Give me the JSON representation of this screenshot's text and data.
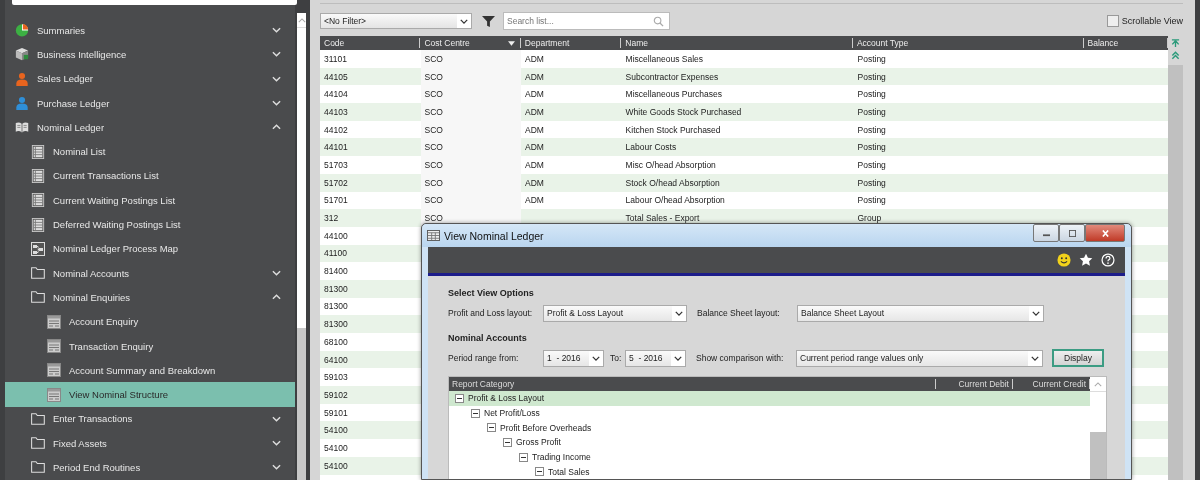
{
  "sidebar": {
    "items": [
      {
        "label": "Summaries",
        "kind": "pie",
        "expanded": false,
        "selected": false
      },
      {
        "label": "Business Intelligence",
        "kind": "box",
        "expanded": false,
        "selected": false
      },
      {
        "label": "Sales Ledger",
        "kind": "person",
        "color": "#e8641e",
        "expanded": false,
        "selected": false
      },
      {
        "label": "Purchase Ledger",
        "kind": "person",
        "color": "#2f8fd8",
        "expanded": false,
        "selected": false
      },
      {
        "label": "Nominal Ledger",
        "kind": "book",
        "expanded": true,
        "selected": false,
        "children": [
          {
            "label": "Nominal List",
            "kind": "list",
            "selected": false
          },
          {
            "label": "Current Transactions List",
            "kind": "list",
            "selected": false
          },
          {
            "label": "Current Waiting Postings List",
            "kind": "list",
            "selected": false
          },
          {
            "label": "Deferred Waiting Postings List",
            "kind": "list",
            "selected": false
          },
          {
            "label": "Nominal Ledger Process Map",
            "kind": "map",
            "selected": false
          },
          {
            "label": "Nominal Accounts",
            "kind": "folder",
            "expanded": false,
            "selected": false
          },
          {
            "label": "Nominal Enquiries",
            "kind": "folder",
            "expanded": true,
            "selected": false,
            "children": [
              {
                "label": "Account Enquiry",
                "kind": "form",
                "selected": false
              },
              {
                "label": "Transaction Enquiry",
                "kind": "form",
                "selected": false
              },
              {
                "label": "Account Summary and Breakdown",
                "kind": "form",
                "selected": false
              },
              {
                "label": "View Nominal Structure",
                "kind": "form",
                "selected": true
              }
            ]
          },
          {
            "label": "Enter Transactions",
            "kind": "folder",
            "expanded": false,
            "selected": false
          },
          {
            "label": "Fixed Assets",
            "kind": "folder",
            "expanded": false,
            "selected": false
          },
          {
            "label": "Period End Routines",
            "kind": "folder",
            "expanded": false,
            "selected": false
          }
        ]
      }
    ]
  },
  "toolbar": {
    "filter": "<No Filter>",
    "search": {
      "placeholder": "Search list..."
    },
    "scrollable_view": {
      "label": "Scrollable View",
      "checked": false
    }
  },
  "table": {
    "columns": [
      {
        "label": "Code",
        "sorted": false
      },
      {
        "label": "Cost Centre",
        "sorted": true
      },
      {
        "label": "Department",
        "sorted": false
      },
      {
        "label": "Name",
        "sorted": false
      },
      {
        "label": "Account Type",
        "sorted": false
      },
      {
        "label": "Balance",
        "sorted": false
      }
    ],
    "rows": [
      [
        "31101",
        "SCO",
        "ADM",
        "Miscellaneous Sales",
        "Posting"
      ],
      [
        "44105",
        "SCO",
        "ADM",
        "Subcontractor Expenses",
        "Posting"
      ],
      [
        "44104",
        "SCO",
        "ADM",
        "Miscellaneous Purchases",
        "Posting"
      ],
      [
        "44103",
        "SCO",
        "ADM",
        "White Goods Stock Purchased",
        "Posting"
      ],
      [
        "44102",
        "SCO",
        "ADM",
        "Kitchen Stock Purchased",
        "Posting"
      ],
      [
        "44101",
        "SCO",
        "ADM",
        "Labour Costs",
        "Posting"
      ],
      [
        "51703",
        "SCO",
        "ADM",
        "Misc O/head Absorption",
        "Posting"
      ],
      [
        "51702",
        "SCO",
        "ADM",
        "Stock O/head Absorption",
        "Posting"
      ],
      [
        "51701",
        "SCO",
        "ADM",
        "Labour O/head Absorption",
        "Posting"
      ],
      [
        "312",
        "SCO",
        "",
        "Total Sales - Export",
        "Group"
      ],
      [
        "44100"
      ],
      [
        "41100"
      ],
      [
        "81400"
      ],
      [
        "81300"
      ],
      [
        "81300"
      ],
      [
        "81300"
      ],
      [
        "68100"
      ],
      [
        "64100"
      ],
      [
        "59103"
      ],
      [
        "59102"
      ],
      [
        "59101"
      ],
      [
        "54100"
      ],
      [
        "54100"
      ],
      [
        "54100"
      ]
    ]
  },
  "dialog": {
    "title": "View Nominal Ledger",
    "section_1": "Select View Options",
    "pl_layout": {
      "label": "Profit and Loss layout:",
      "value": "Profit & Loss Layout"
    },
    "bs_layout": {
      "label": "Balance Sheet layout:",
      "value": "Balance Sheet Layout"
    },
    "section_2": "Nominal Accounts",
    "period_from": {
      "label": "Period range from:",
      "value": "1  - 2016"
    },
    "period_to": {
      "label": "To:",
      "value": "5  - 2016"
    },
    "comparison": {
      "label": "Show comparison with:",
      "value": "Current period range values only"
    },
    "display_button": "Display",
    "tree": {
      "columns": [
        "Report Category",
        "Current Debit",
        "Current Credit"
      ],
      "items": [
        {
          "label": "Profit & Loss Layout",
          "selected": true,
          "expanded": true,
          "children": [
            {
              "label": "Net Profit/Loss",
              "selected": false,
              "expanded": true,
              "children": [
                {
                  "label": "Profit Before Overheads",
                  "selected": false,
                  "expanded": true,
                  "children": [
                    {
                      "label": "Gross Profit",
                      "selected": false,
                      "expanded": true,
                      "children": [
                        {
                          "label": "Trading Income",
                          "selected": false,
                          "expanded": true,
                          "children": [
                            {
                              "label": "Total Sales",
                              "selected": false,
                              "expanded": true
                            }
                          ]
                        }
                      ]
                    }
                  ]
                }
              ]
            }
          ]
        }
      ]
    }
  }
}
